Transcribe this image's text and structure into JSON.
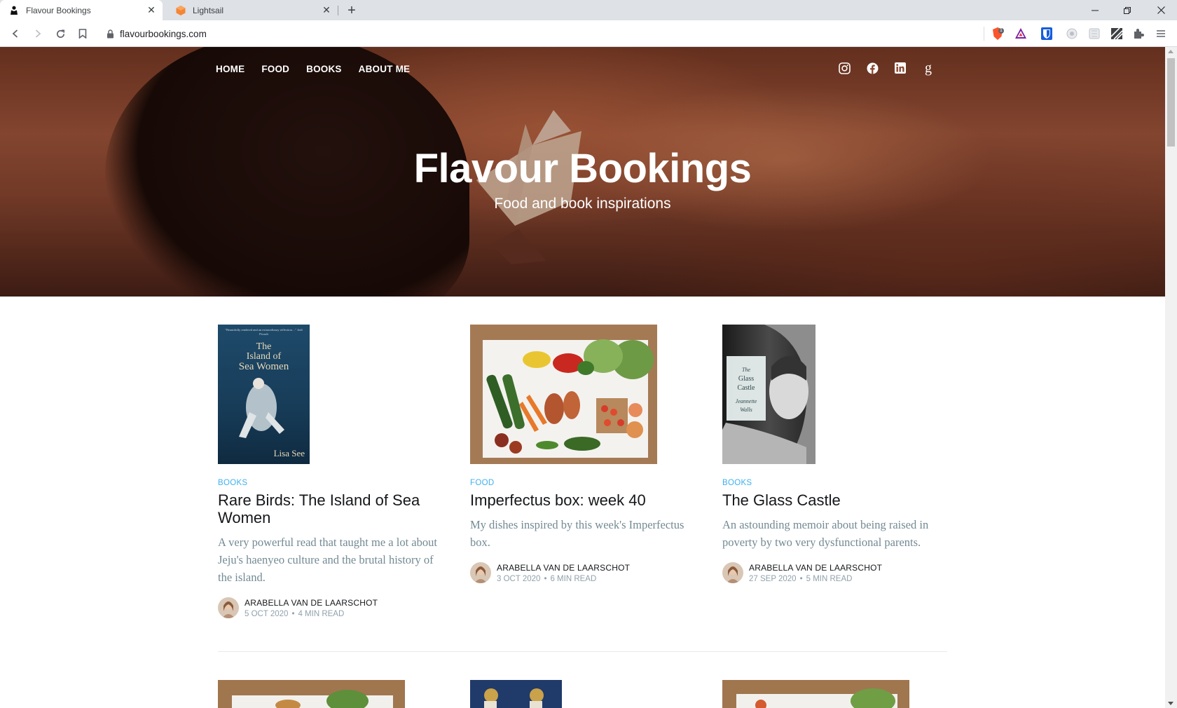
{
  "browser": {
    "tabs": [
      {
        "title": "Flavour Bookings",
        "active": true,
        "icon": "book-reader-icon"
      },
      {
        "title": "Lightsail",
        "active": false,
        "icon": "lightsail-cube-icon"
      }
    ],
    "url": "flavourbookings.com",
    "brave_badge": "1"
  },
  "site": {
    "nav": [
      "HOME",
      "FOOD",
      "BOOKS",
      "ABOUT ME"
    ],
    "social_icons": [
      "instagram-icon",
      "facebook-icon",
      "linkedin-icon",
      "goodreads-icon"
    ],
    "goodreads_glyph": "g",
    "title": "Flavour Bookings",
    "subtitle": "Food and book inspirations"
  },
  "posts": [
    {
      "tag": "BOOKS",
      "title": "Rare Birds: The Island of Sea Women",
      "excerpt": "A very powerful read that taught me a lot about Jeju's haenyeo culture and the brutal history of the island.",
      "author": "ARABELLA VAN DE LAARSCHOT",
      "date": "5 OCT 2020",
      "read": "4 MIN READ",
      "cover": {
        "top": "\"Beautifully rendered and an extraordinary reflection…\" Jodi Picoult",
        "title1": "The",
        "title2": "Island of",
        "title3": "Sea Women",
        "author": "Lisa See"
      }
    },
    {
      "tag": "FOOD",
      "title": "Imperfectus box: week 40",
      "excerpt": "My dishes inspired by this week's Imperfectus box.",
      "author": "ARABELLA VAN DE LAARSCHOT",
      "date": "3 OCT 2020",
      "read": "6 MIN READ"
    },
    {
      "tag": "BOOKS",
      "title": "The Glass Castle",
      "excerpt": "An astounding memoir about being raised in poverty by two very dysfunctional parents.",
      "author": "ARABELLA VAN DE LAARSCHOT",
      "date": "27 SEP 2020",
      "read": "5 MIN READ",
      "cover": {
        "line1": "The",
        "line2": "Glass",
        "line3": "Castle",
        "author1": "Jeannette",
        "author2": "Walls"
      }
    }
  ],
  "colors": {
    "accent": "#3eb0ef",
    "excerpt": "#738a94",
    "meta": "#90a2aa"
  }
}
